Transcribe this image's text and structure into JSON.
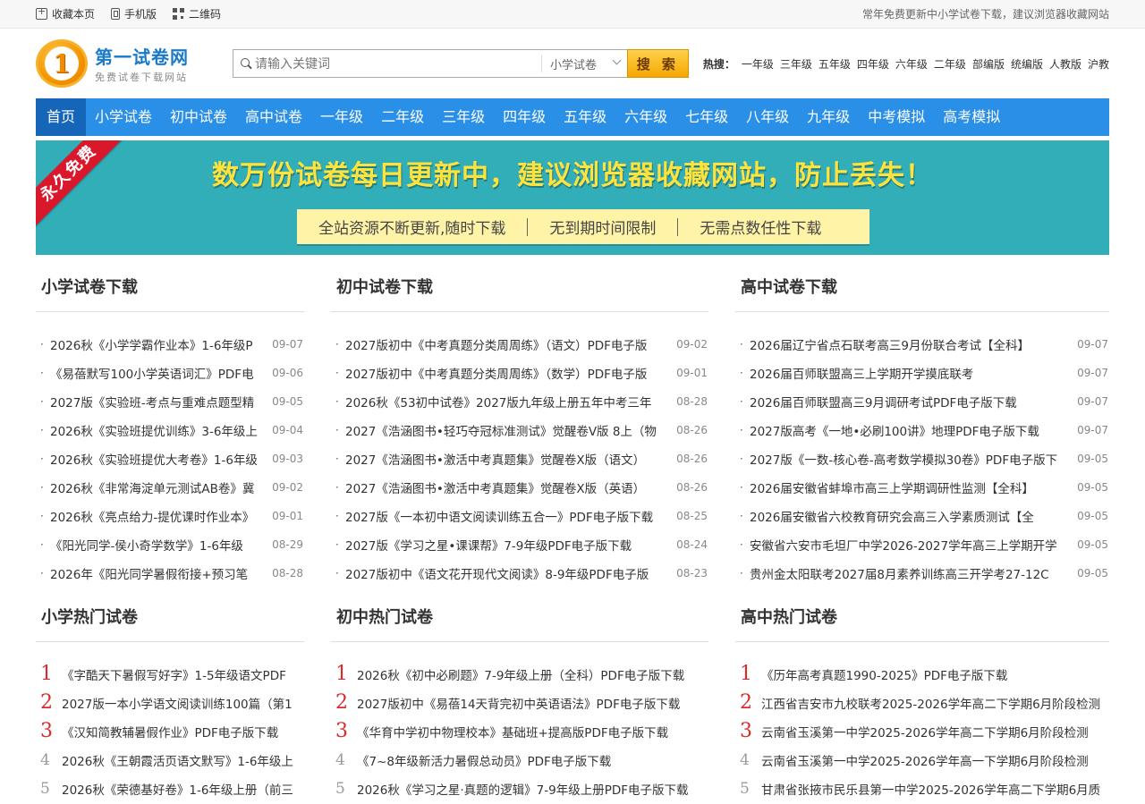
{
  "topbar": {
    "links": [
      {
        "label": "收藏本页",
        "icon": "bookmark-add-icon"
      },
      {
        "label": "手机版",
        "icon": "mobile-icon"
      },
      {
        "label": "二维码",
        "icon": "qr-code-icon"
      }
    ],
    "notice": "常年免费更新中小学试卷下载，建议浏览器收藏网站"
  },
  "logo": {
    "badge": "1",
    "title": "第一试卷网",
    "subtitle": "免费试卷下载网站"
  },
  "search": {
    "placeholder": "请输入关键词",
    "category": "小学试卷",
    "button": "搜 索"
  },
  "hot": {
    "label": "热搜：",
    "terms": [
      "一年级",
      "三年级",
      "五年级",
      "四年级",
      "六年级",
      "二年级",
      "部编版",
      "统编版",
      "人教版",
      "沪教"
    ]
  },
  "nav": [
    "首页",
    "小学试卷",
    "初中试卷",
    "高中试卷",
    "一年级",
    "二年级",
    "三年级",
    "四年级",
    "五年级",
    "六年级",
    "七年级",
    "八年级",
    "九年级",
    "中考模拟",
    "高考模拟"
  ],
  "banner": {
    "ribbon": "永久免费",
    "title": "数万份试卷每日更新中，建议浏览器收藏网站，防止丢失！",
    "features": [
      "全站资源不断更新,随时下载",
      "无到期时间限制",
      "无需点数任性下载"
    ]
  },
  "sections": {
    "primary_dl": {
      "title": "小学试卷下载",
      "items": [
        {
          "t": "2026秋《小学学霸作业本》1-6年级P",
          "d": "09-07"
        },
        {
          "t": "《易蓓默写100小学英语词汇》PDF电",
          "d": "09-06"
        },
        {
          "t": "2027版《实验班-考点与重难点题型精",
          "d": "09-05"
        },
        {
          "t": "2026秋《实验班提优训练》3-6年级上",
          "d": "09-04"
        },
        {
          "t": "2026秋《实验班提优大考卷》1-6年级",
          "d": "09-03"
        },
        {
          "t": "2026秋《非常海淀单元测试AB卷》冀",
          "d": "09-02"
        },
        {
          "t": "2026秋《亮点给力-提优课时作业本》",
          "d": "09-01"
        },
        {
          "t": "《阳光同学-侯小奇学数学》1-6年级",
          "d": "08-29"
        },
        {
          "t": "2026年《阳光同学暑假衔接+预习笔",
          "d": "08-28"
        }
      ]
    },
    "middle_dl": {
      "title": "初中试卷下载",
      "items": [
        {
          "t": "2027版初中《中考真题分类周周练》（语文）PDF电子版",
          "d": "09-02"
        },
        {
          "t": "2027版初中《中考真题分类周周练》（数学）PDF电子版",
          "d": "09-01"
        },
        {
          "t": "2026秋《53初中试卷》2027版九年级上册五年中考三年",
          "d": "08-28"
        },
        {
          "t": "2027《浩涵图书•轻巧夺冠标准测试》觉醒卷V版 8上（物",
          "d": "08-26"
        },
        {
          "t": "2027《浩涵图书•激活中考真题集》觉醒卷X版（语文）",
          "d": "08-26"
        },
        {
          "t": "2027《浩涵图书•激活中考真题集》觉醒卷X版（英语）",
          "d": "08-26"
        },
        {
          "t": "2027版《一本初中语文阅读训练五合一》PDF电子版下载",
          "d": "08-25"
        },
        {
          "t": "2027版《学习之星•课课帮》7-9年级PDF电子版下载",
          "d": "08-24"
        },
        {
          "t": "2027版初中《语文花开现代文阅读》8-9年级PDF电子版",
          "d": "08-23"
        }
      ]
    },
    "high_dl": {
      "title": "高中试卷下载",
      "items": [
        {
          "t": "2026届辽宁省点石联考高三9月份联合考试【全科】",
          "d": "09-07"
        },
        {
          "t": "2026届百师联盟高三上学期开学摸底联考",
          "d": "09-07"
        },
        {
          "t": "2026届百师联盟高三9月调研考试PDF电子版下载",
          "d": "09-07"
        },
        {
          "t": "2027版高考《一地•必刷100讲》地理PDF电子版下载",
          "d": "09-07"
        },
        {
          "t": "2027版《一数-核心卷-高考数学模拟30卷》PDF电子版下",
          "d": "09-05"
        },
        {
          "t": "2026届安徽省蚌埠市高三上学期调研性监测【全科】",
          "d": "09-05"
        },
        {
          "t": "2026届安徽省六校教育研究会高三入学素质测试【全",
          "d": "09-05"
        },
        {
          "t": "安徽省六安市毛坦厂中学2026-2027学年高三上学期开学",
          "d": "09-05"
        },
        {
          "t": "贵州金太阳联考2027届8月素养训练高三开学考27-12C",
          "d": "09-05"
        }
      ]
    },
    "primary_hot": {
      "title": "小学热门试卷",
      "items": [
        {
          "n": "1",
          "t": "《字酷天下暑假写好字》1-5年级语文PDF"
        },
        {
          "n": "2",
          "t": "2027版一本小学语文阅读训练100篇（第1"
        },
        {
          "n": "3",
          "t": "《汉知简教辅暑假作业》PDF电子版下载"
        },
        {
          "n": "4",
          "t": "2026秋《王朝霞活页语文默写》1-6年级上"
        },
        {
          "n": "5",
          "t": "2026秋《荣德基好卷》1-6年级上册（前三"
        }
      ]
    },
    "middle_hot": {
      "title": "初中热门试卷",
      "items": [
        {
          "n": "1",
          "t": "2026秋《初中必刷题》7-9年级上册（全科）PDF电子版下载"
        },
        {
          "n": "2",
          "t": "2027版初中《易蓓14天背完初中英语语法》PDF电子版下载"
        },
        {
          "n": "3",
          "t": "《华育中学初中物理校本》基础班+提高版PDF电子版下载"
        },
        {
          "n": "4",
          "t": "《7~8年级新活力暑假总动员》PDF电子版下载"
        },
        {
          "n": "5",
          "t": "2026秋《学习之星·真题的逻辑》7-9年级上册PDF电子版下载"
        }
      ]
    },
    "high_hot": {
      "title": "高中热门试卷",
      "items": [
        {
          "n": "1",
          "t": "《历年高考真题1990-2025》PDF电子版下载"
        },
        {
          "n": "2",
          "t": "江西省吉安市九校联考2025-2026学年高二下学期6月阶段检测"
        },
        {
          "n": "3",
          "t": "云南省玉溪第一中学2025-2026学年高二下学期6月阶段检测"
        },
        {
          "n": "4",
          "t": "云南省玉溪第一中学2025-2026学年高一下学期6月阶段检测"
        },
        {
          "n": "5",
          "t": "甘肃省张掖市民乐县第一中学2025-2026学年高二下学期6月质"
        }
      ]
    }
  },
  "colors": {
    "nav_bg": "#2a8fe6",
    "nav_home_bg": "#1565b8",
    "banner_bg": "#31aeb8",
    "banner_title": "#ffe23b",
    "ribbon": "#d9182b",
    "search_btn": "#f5a700",
    "hot_rank": "#d82c2c"
  }
}
